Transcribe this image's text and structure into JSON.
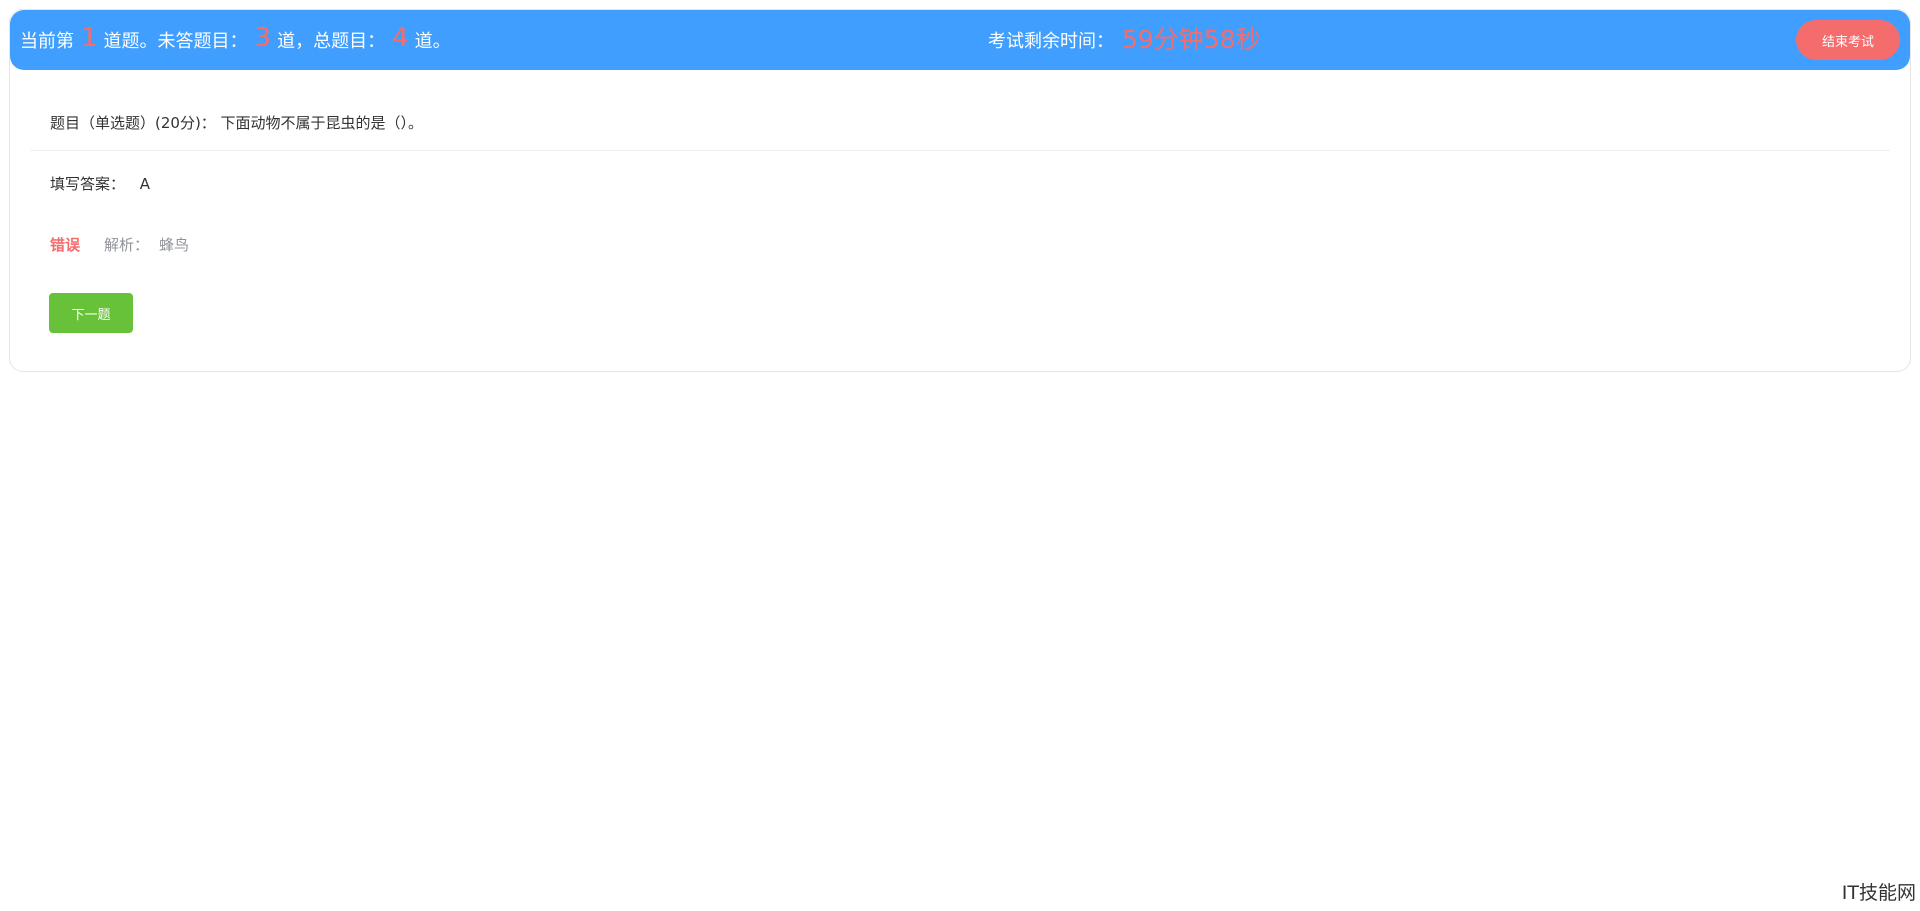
{
  "header": {
    "progress_prefix": "当前第",
    "current_number": "1",
    "progress_mid1": "道题。未答题目：",
    "unanswered_count": "3",
    "progress_mid2": "道，总题目：",
    "total_count": "4",
    "progress_suffix": "道。",
    "timer_label": "考试剩余时间：",
    "timer_value": "59分钟58秒",
    "end_exam_label": "结束考试"
  },
  "question": {
    "text": "题目（单选题）(20分)：  下面动物不属于昆虫的是（）。"
  },
  "answer": {
    "label": "填写答案：",
    "value": "A"
  },
  "result": {
    "status": "错误",
    "analysis_label": "解析：",
    "analysis_value": "蜂鸟"
  },
  "actions": {
    "next_label": "下一题"
  },
  "watermark": {
    "text": "IT技能网"
  },
  "colors": {
    "header_bg": "#409eff",
    "accent_red": "#f56c6c",
    "next_green": "#67c23a"
  }
}
